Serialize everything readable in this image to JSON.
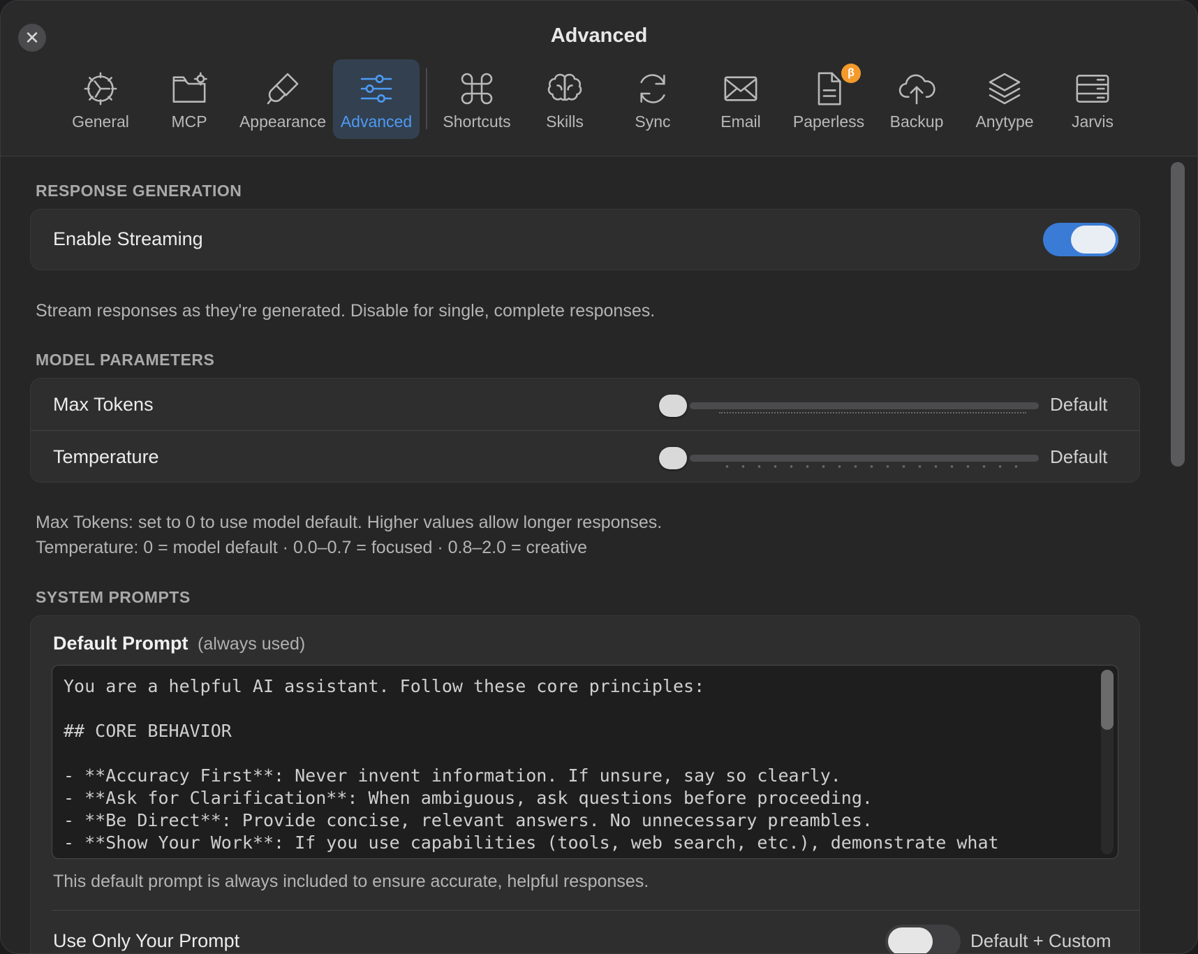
{
  "window": {
    "title": "Advanced"
  },
  "tabs": [
    {
      "label": "General",
      "icon": "gear-icon"
    },
    {
      "label": "MCP",
      "icon": "folder-gear-icon"
    },
    {
      "label": "Appearance",
      "icon": "paintbrush-icon"
    },
    {
      "label": "Advanced",
      "icon": "sliders-icon",
      "active": true
    },
    {
      "label": "Shortcuts",
      "icon": "command-icon"
    },
    {
      "label": "Skills",
      "icon": "brain-icon"
    },
    {
      "label": "Sync",
      "icon": "sync-icon"
    },
    {
      "label": "Email",
      "icon": "envelope-icon"
    },
    {
      "label": "Paperless",
      "icon": "document-icon",
      "badge": "β"
    },
    {
      "label": "Backup",
      "icon": "cloud-upload-icon"
    },
    {
      "label": "Anytype",
      "icon": "layers-icon"
    },
    {
      "label": "Jarvis",
      "icon": "server-icon"
    }
  ],
  "response_generation": {
    "title": "RESPONSE GENERATION",
    "streaming_label": "Enable Streaming",
    "streaming_on": true,
    "description": "Stream responses as they're generated. Disable for single, complete responses."
  },
  "model_parameters": {
    "title": "MODEL PARAMETERS",
    "max_tokens_label": "Max Tokens",
    "max_tokens_value": "Default",
    "max_tokens_level": 0,
    "temperature_label": "Temperature",
    "temperature_value": "Default",
    "temperature_level": 0,
    "description_line1": "Max Tokens: set to 0 to use model default. Higher values allow longer responses.",
    "description_line2": "Temperature: 0 = model default · 0.0–0.7 = focused · 0.8–2.0 = creative"
  },
  "system_prompts": {
    "title": "SYSTEM PROMPTS",
    "default_prompt_label": "Default Prompt",
    "default_prompt_hint": "(always used)",
    "default_prompt_text": "You are a helpful AI assistant. Follow these core principles:\n\n## CORE BEHAVIOR\n\n- **Accuracy First**: Never invent information. If unsure, say so clearly.\n- **Ask for Clarification**: When ambiguous, ask questions before proceeding.\n- **Be Direct**: Provide concise, relevant answers. No unnecessary preambles.\n- **Show Your Work**: If you use capabilities (tools, web search, etc.), demonstrate what",
    "default_prompt_note": "This default prompt is always included to ensure accurate, helpful responses.",
    "use_only_label": "Use Only Your Prompt",
    "use_only_on": false,
    "use_only_value": "Default + Custom"
  }
}
